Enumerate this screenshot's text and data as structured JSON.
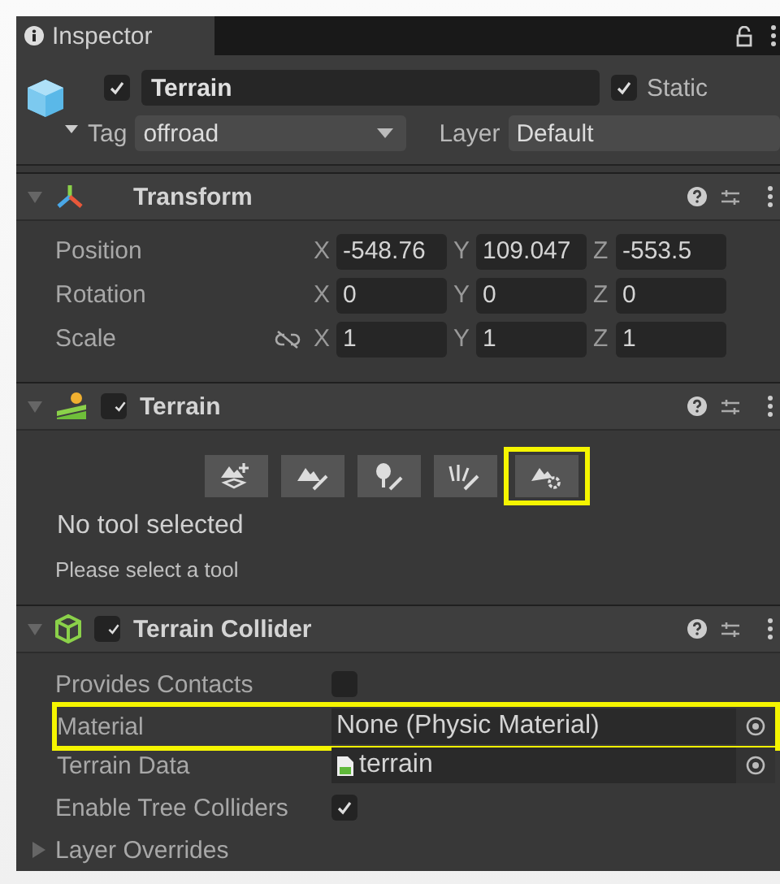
{
  "tab": {
    "title": "Inspector"
  },
  "object": {
    "active": true,
    "name": "Terrain",
    "static": true,
    "static_label": "Static",
    "tag_label": "Tag",
    "tag": "offroad",
    "layer_label": "Layer",
    "layer": "Default"
  },
  "components": [
    {
      "kind": "transform",
      "title": "Transform",
      "expanded": true,
      "rows": [
        {
          "label": "Position",
          "link": false,
          "values": [
            {
              "axis": "X",
              "value": "-548.76"
            },
            {
              "axis": "Y",
              "value": "109.047"
            },
            {
              "axis": "Z",
              "value": "-553.5"
            }
          ]
        },
        {
          "label": "Rotation",
          "link": false,
          "values": [
            {
              "axis": "X",
              "value": "0"
            },
            {
              "axis": "Y",
              "value": "0"
            },
            {
              "axis": "Z",
              "value": "0"
            }
          ]
        },
        {
          "label": "Scale",
          "link": true,
          "values": [
            {
              "axis": "X",
              "value": "1"
            },
            {
              "axis": "Y",
              "value": "1"
            },
            {
              "axis": "Z",
              "value": "1"
            }
          ]
        }
      ]
    },
    {
      "kind": "terrain",
      "title": "Terrain",
      "enabled": true,
      "expanded": true,
      "tools": [
        {
          "kind": "create",
          "selected": false,
          "highlighted": false
        },
        {
          "kind": "paint",
          "selected": false,
          "highlighted": false
        },
        {
          "kind": "trees",
          "selected": false,
          "highlighted": false
        },
        {
          "kind": "details",
          "selected": false,
          "highlighted": false
        },
        {
          "kind": "settings",
          "selected": false,
          "highlighted": true
        }
      ],
      "status": "No tool selected",
      "hint": "Please select a tool"
    },
    {
      "kind": "collider",
      "title": "Terrain Collider",
      "enabled": true,
      "expanded": true,
      "properties": [
        {
          "kind": "checkbox",
          "label": "Provides Contacts",
          "checked": false
        },
        {
          "kind": "object",
          "label": "Material",
          "value": "None (Physic Material)",
          "asset": false,
          "highlighted": true
        },
        {
          "kind": "object",
          "label": "Terrain Data",
          "value": "terrain",
          "asset": true,
          "highlighted": false
        },
        {
          "kind": "checkbox",
          "label": "Enable Tree Colliders",
          "checked": true
        },
        {
          "kind": "foldout",
          "label": "Layer Overrides",
          "expanded": false
        }
      ]
    }
  ]
}
